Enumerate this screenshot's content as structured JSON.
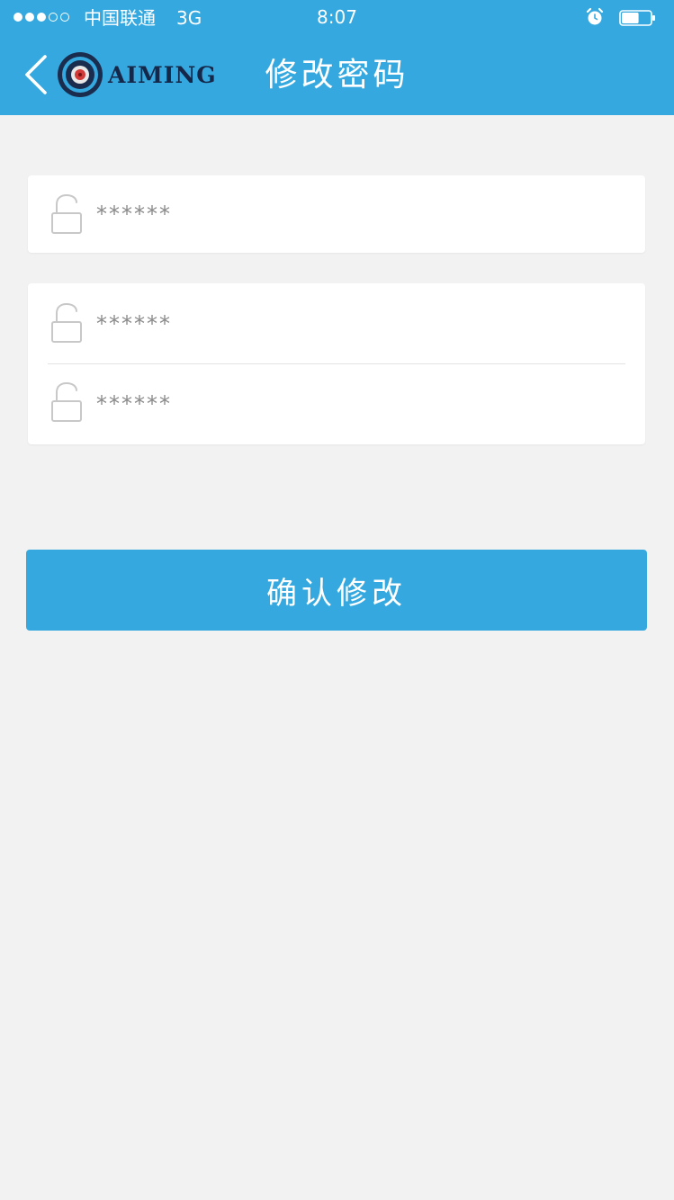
{
  "status_bar": {
    "carrier": "中国联通",
    "network": "3G",
    "time": "8:07",
    "signal_bars_filled": 3,
    "signal_bars_total": 5,
    "battery_level": 0.6
  },
  "nav": {
    "title": "修改密码",
    "brand_text": "AIMING",
    "back_icon": "chevron-left-icon"
  },
  "form": {
    "old_password": {
      "placeholder": "******",
      "icon": "lock-icon"
    },
    "new_password": {
      "placeholder": "******",
      "icon": "lock-icon"
    },
    "confirm_password": {
      "placeholder": "******",
      "icon": "lock-icon"
    }
  },
  "actions": {
    "confirm_label": "确认修改"
  },
  "colors": {
    "primary": "#35a9df",
    "background": "#f2f2f2",
    "card": "#ffffff",
    "brand_text": "#15284a"
  }
}
